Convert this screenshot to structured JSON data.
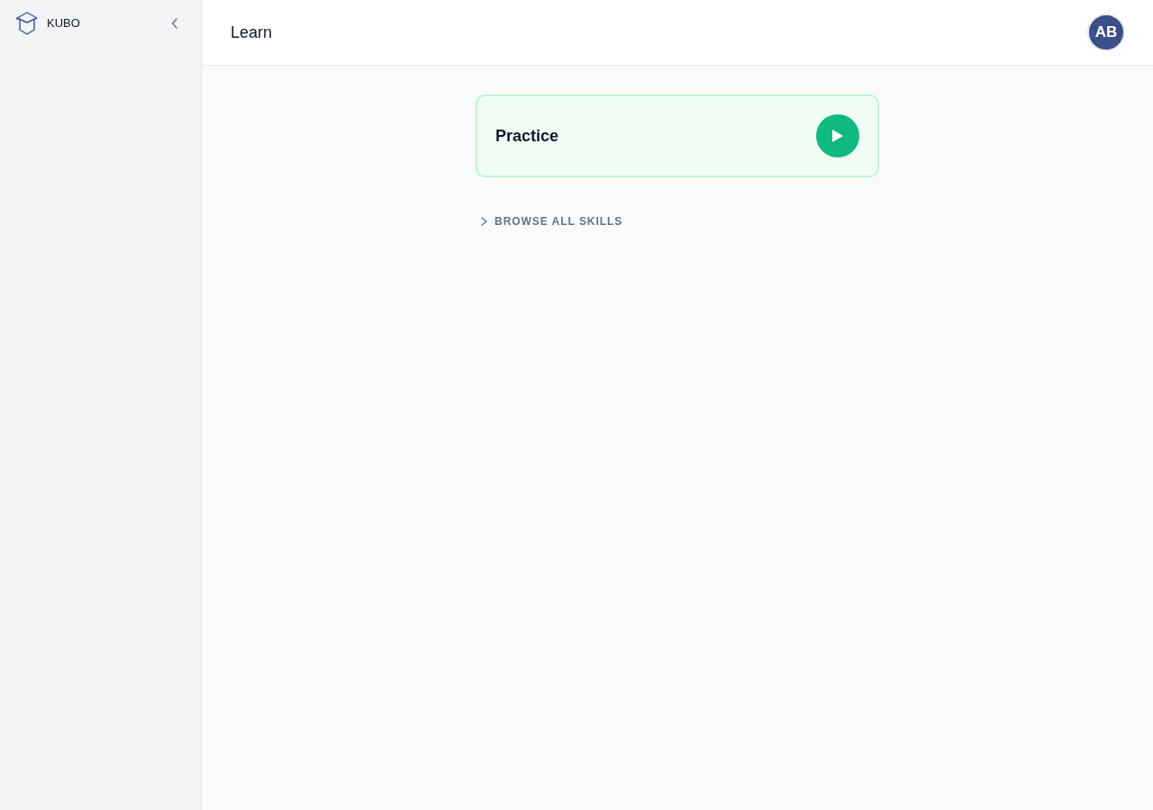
{
  "sidebar": {
    "brand": "KUBO"
  },
  "header": {
    "title": "Learn",
    "avatar": "AB"
  },
  "practice_card": {
    "title": "Practice"
  },
  "browse": {
    "label": "BROWSE ALL SKILLS",
    "expanded": false
  }
}
